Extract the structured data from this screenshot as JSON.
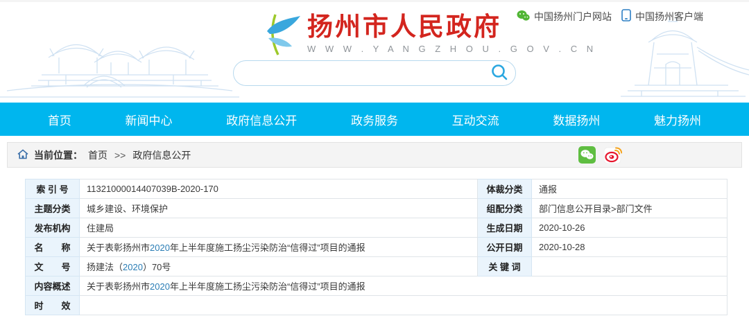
{
  "colors": {
    "nav_bg": "#00b6ee",
    "title_red": "#d3251e",
    "label_bg": "#eaf4fc",
    "highlight": "#2a7db5"
  },
  "header": {
    "site_title": "扬州市人民政府",
    "site_url": "W W W . Y A N G Z H O U . G O V . C N",
    "top_links": [
      {
        "label": "中国扬州门户网站",
        "icon": "wechat-icon"
      },
      {
        "label": "中国扬州客户端",
        "icon": "mobile-icon"
      }
    ],
    "search": {
      "value": "",
      "placeholder": ""
    }
  },
  "nav": {
    "items": [
      "首页",
      "新闻中心",
      "政府信息公开",
      "政务服务",
      "互动交流",
      "数据扬州",
      "魅力扬州"
    ]
  },
  "breadcrumb": {
    "label": "当前位置：",
    "home": "首页",
    "separator": ">>",
    "current": "政府信息公开"
  },
  "info_table": {
    "r1": {
      "l1": "索 引 号",
      "v1": "11321000014407039B-2020-170",
      "l2": "体裁分类",
      "v2": "通报"
    },
    "r2": {
      "l1": "主题分类",
      "v1": "城乡建设、环境保护",
      "l2": "组配分类",
      "v2": "部门信息公开目录>部门文件"
    },
    "r3": {
      "l1": "发布机构",
      "v1": "住建局",
      "l2": "生成日期",
      "v2": "2020-10-26"
    },
    "r4": {
      "l1": "名　　称",
      "v1_pre": "关于表彰扬州市",
      "v1_hl": "2020",
      "v1_post": "年上半年度施工扬尘污染防治“信得过”项目的通报",
      "l2": "公开日期",
      "v2": "2020-10-28"
    },
    "r5": {
      "l1": "文　　号",
      "v1_pre": "扬建法（",
      "v1_hl": "2020",
      "v1_post": "）70号",
      "l2": "关 键 词",
      "v2": ""
    },
    "r6": {
      "l1": "内容概述",
      "v1_pre": "关于表彰扬州市",
      "v1_hl": "2020",
      "v1_post": "年上半年度施工扬尘污染防治“信得过”项目的通报"
    },
    "r7": {
      "l1": "时　　效",
      "v1": ""
    }
  }
}
